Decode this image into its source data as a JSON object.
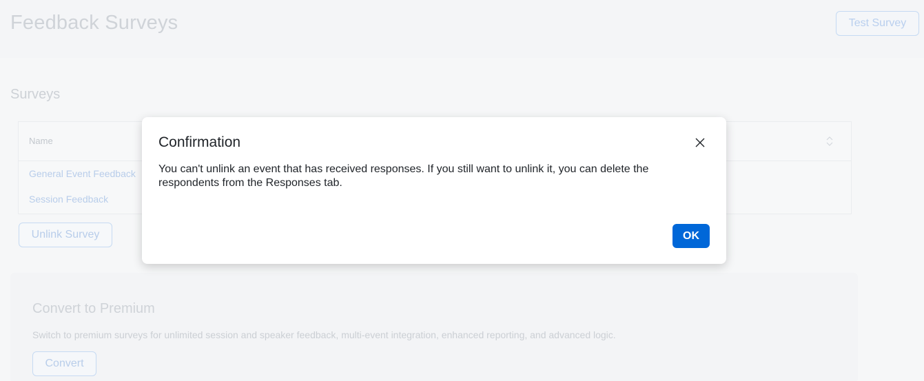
{
  "header": {
    "title": "Feedback Surveys",
    "test_survey_label": "Test Survey"
  },
  "surveys": {
    "section_title": "Surveys",
    "table": {
      "columns": [
        "Name"
      ],
      "rows": [
        {
          "name": "General Event Feedback"
        },
        {
          "name": "Session Feedback"
        }
      ]
    },
    "unlink_label": "Unlink Survey"
  },
  "premium": {
    "title": "Convert to Premium",
    "description": "Switch to premium surveys for unlimited session and speaker feedback, multi-event integration, enhanced reporting, and advanced logic.",
    "convert_label": "Convert"
  },
  "modal": {
    "title": "Confirmation",
    "body": "You can't unlink an event that has received responses. If you still want to unlink it, you can delete the respondents from the Responses tab.",
    "ok_label": "OK"
  },
  "colors": {
    "primary": "#0067d8",
    "modal_bg": "#ffffff",
    "page_bg": "#f5f6f8"
  },
  "icons": {
    "close": "close-icon",
    "sort": "sort-icon"
  }
}
